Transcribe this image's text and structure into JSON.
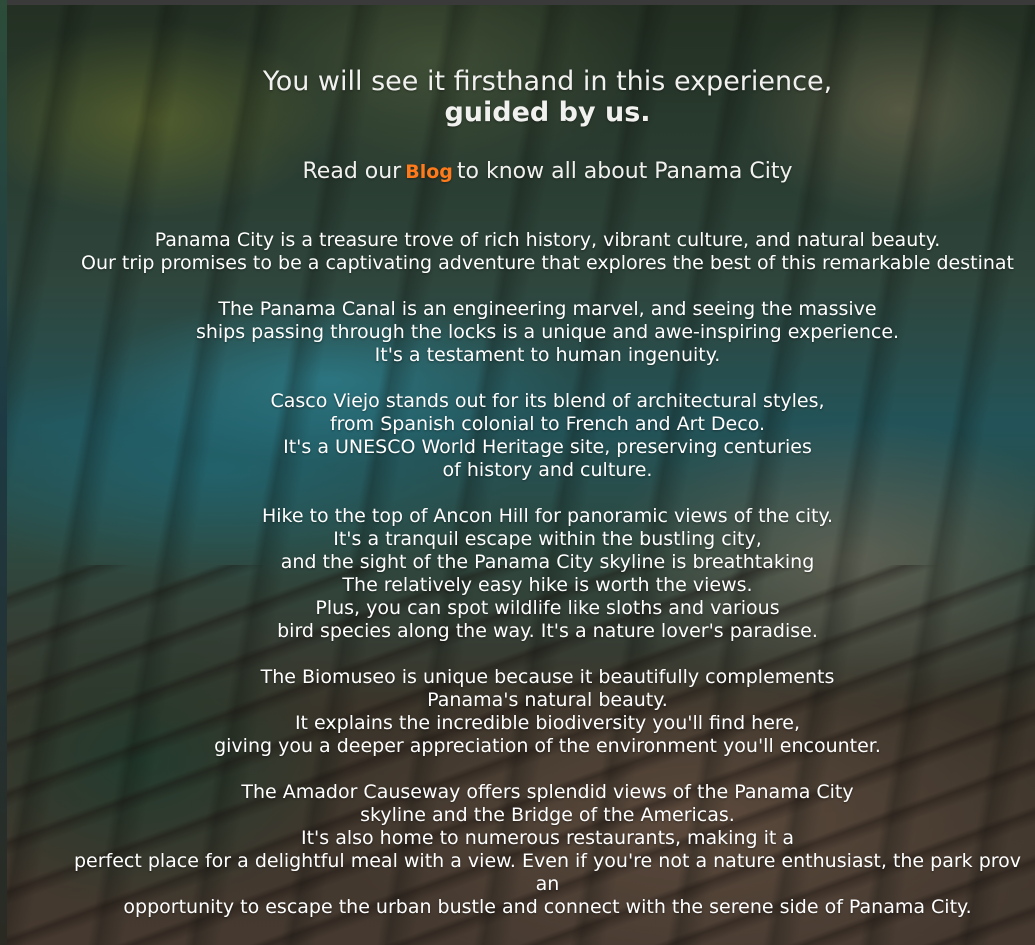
{
  "headline": {
    "line1": "You will see it firsthand in this experience,",
    "line2": "guided by us."
  },
  "blog": {
    "before": "Read our",
    "link": "Blog",
    "after": "to know all about Panama City"
  },
  "paragraphs": [
    {
      "lines": [
        "Panama City is a treasure trove of rich history, vibrant culture, and natural beauty.",
        "Our trip promises to be a captivating adventure that explores the best of this remarkable destinat"
      ]
    },
    {
      "lines": [
        "The Panama Canal is an engineering marvel, and seeing the massive",
        "ships passing through the locks is a unique and awe-inspiring experience.",
        "It's a testament to human ingenuity."
      ]
    },
    {
      "lines": [
        "Casco Viejo stands out for its blend of architectural styles,",
        "from Spanish colonial to French and Art Deco.",
        "It's a UNESCO World Heritage site, preserving centuries",
        "of history and culture."
      ]
    },
    {
      "lines": [
        "Hike to the top of Ancon Hill for panoramic views of the city.",
        "It's a tranquil escape within the bustling city,",
        "and the sight of the Panama City skyline is breathtaking",
        "The relatively easy hike is worth the views.",
        "Plus, you can spot wildlife like sloths and various",
        "bird species along the way. It's a nature lover's paradise."
      ]
    },
    {
      "lines": [
        "The Biomuseo is unique because it beautifully complements",
        "Panama's natural beauty.",
        "It explains the incredible biodiversity you'll find here,",
        "giving you a deeper appreciation of the environment you'll encounter."
      ]
    },
    {
      "lines": [
        "The Amador Causeway offers splendid views of the Panama City",
        "skyline and the Bridge of the Americas.",
        "It's also home to numerous restaurants, making it a",
        "perfect place for a delightful meal with a view. Even if you're not a nature enthusiast, the park prov",
        "an",
        "opportunity to escape the urban bustle and connect with the serene side of Panama City."
      ]
    }
  ],
  "colors": {
    "accent": "#ff7a1a",
    "text": "#ffffff"
  }
}
